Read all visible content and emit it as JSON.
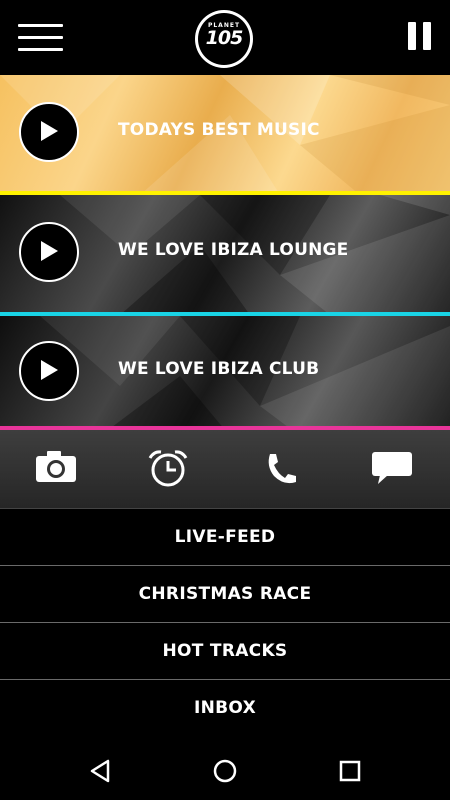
{
  "header": {
    "logo_top": "PLANET",
    "logo_main": "105",
    "menu_icon": "hamburger-menu-icon",
    "pause_icon": "pause-icon"
  },
  "stations": [
    {
      "title": "TODAYS BEST MUSIC",
      "accent": "#fff200"
    },
    {
      "title": "WE LOVE IBIZA LOUNGE",
      "accent": "#19d4e6"
    },
    {
      "title": "WE LOVE IBIZA CLUB",
      "accent": "#e8359a"
    }
  ],
  "actions": [
    {
      "icon": "camera-icon"
    },
    {
      "icon": "alarm-clock-icon"
    },
    {
      "icon": "phone-icon"
    },
    {
      "icon": "chat-bubble-icon"
    }
  ],
  "menu": [
    {
      "label": "LIVE-FEED"
    },
    {
      "label": "CHRISTMAS RACE"
    },
    {
      "label": "HOT TRACKS"
    },
    {
      "label": "INBOX"
    }
  ],
  "system_nav": [
    {
      "icon": "back-triangle-icon"
    },
    {
      "icon": "home-circle-icon"
    },
    {
      "icon": "recents-square-icon"
    }
  ]
}
